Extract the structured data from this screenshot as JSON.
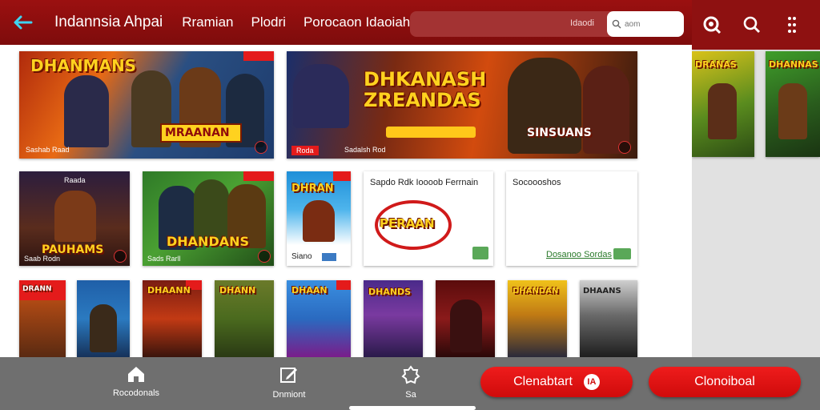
{
  "header": {
    "title": "Indannsia Ahpai",
    "tabs": [
      "Rramian",
      "Plodri",
      "Porocaon Idaoiahin"
    ],
    "search_hint": "Idaodi",
    "search_placeholder": "aom"
  },
  "colors": {
    "brand": "#8e1111",
    "accent": "#e41b1b",
    "title_gold": "#ffd21f"
  },
  "cards": {
    "c1": {
      "title": "DHANMANS",
      "banner": "MRAANAN",
      "caption": "Sashab Raad"
    },
    "c2": {
      "title": "DHKANASH ZREANDAS",
      "subtitle": "SINSUANS",
      "chip_a": "Roda",
      "chip_b": "Sadalsh Rod"
    },
    "c3": {
      "top": "Raada",
      "title": "PAUHAMS",
      "caption": "Saab Rodn"
    },
    "c4": {
      "title": "DHANDANS",
      "caption": "Sads Rarll"
    },
    "c5": {
      "title": "DHRAN",
      "caption": "Siano"
    },
    "c6": {
      "text": "Sapdo Rdk Ioooob Ferrnain",
      "logo": "PERAAN"
    },
    "c7": {
      "text": "Socoooshos",
      "link": "Dosanoo Sordas"
    },
    "r3": [
      "DRANN",
      "",
      "DHAANN",
      "DHANN",
      "DHAAN",
      "DHANDS",
      "",
      "DHANDAN",
      "DHAANS"
    ]
  },
  "right_panel": {
    "card1": "DRANAS",
    "card2": "DHANNAS"
  },
  "bottom": {
    "home_label": "Rocodonals",
    "edit_label": "Dnmiont",
    "fav_label": "Sa",
    "pill1": "Clenabtart",
    "pill1_icon": "IA",
    "pill2": "Clonoiboal"
  }
}
